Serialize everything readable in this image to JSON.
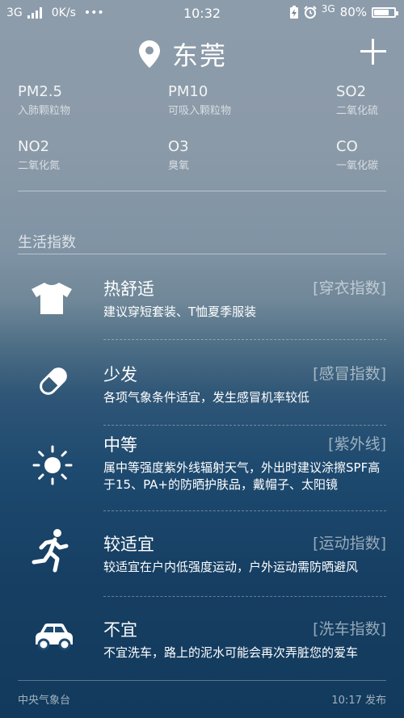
{
  "status": {
    "network": "3G",
    "speed": "0K/s",
    "more": "•••",
    "time": "10:32",
    "network_right": "3G",
    "battery": "80%",
    "battery_level": 0.8
  },
  "city": {
    "name": "东莞"
  },
  "air_quality": [
    {
      "label": "PM2.5",
      "sub": "入肺颗粒物"
    },
    {
      "label": "PM10",
      "sub": "可吸入颗粒物"
    },
    {
      "label": "SO2",
      "sub": "二氧化硫"
    },
    {
      "label": "NO2",
      "sub": "二氧化氮"
    },
    {
      "label": "O3",
      "sub": "臭氧"
    },
    {
      "label": "CO",
      "sub": "一氧化碳"
    }
  ],
  "life": {
    "title": "生活指数",
    "items": [
      {
        "icon": "tshirt-icon",
        "title": "热舒适",
        "tag": "[穿衣指数]",
        "desc": "建议穿短套装、T恤夏季服装"
      },
      {
        "icon": "pill-icon",
        "title": "少发",
        "tag": "[感冒指数]",
        "desc": "各项气象条件适宜，发生感冒机率较低"
      },
      {
        "icon": "sun-icon",
        "title": "中等",
        "tag": "[紫外线]",
        "desc": "属中等强度紫外线辐射天气，外出时建议涂擦SPF高于15、PA+的防晒护肤品，戴帽子、太阳镜"
      },
      {
        "icon": "runner-icon",
        "title": "较适宜",
        "tag": "[运动指数]",
        "desc": "较适宜在户内低强度运动，户外运动需防晒避风"
      },
      {
        "icon": "car-icon",
        "title": "不宜",
        "tag": "[洗车指数]",
        "desc": "不宜洗车，路上的泥水可能会再次弄脏您的爱车"
      }
    ]
  },
  "footer": {
    "source": "中央气象台",
    "publish": "10:17 发布"
  }
}
